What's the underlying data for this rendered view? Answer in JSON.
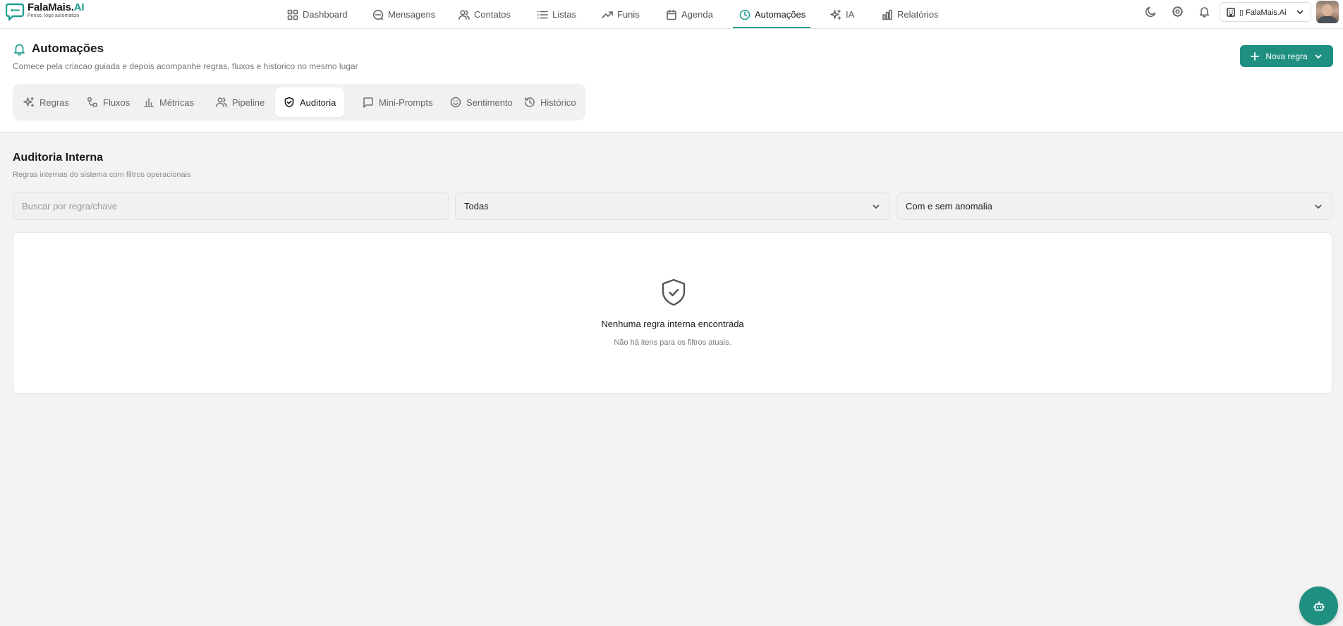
{
  "brand": {
    "name_main": "FalaMais.",
    "name_accent": "AI",
    "tagline": "Penso, logo automatizo"
  },
  "nav": [
    {
      "label": "Dashboard",
      "icon": "grid-icon"
    },
    {
      "label": "Mensagens",
      "icon": "chat-icon"
    },
    {
      "label": "Contatos",
      "icon": "users-icon"
    },
    {
      "label": "Listas",
      "icon": "list-icon"
    },
    {
      "label": "Funis",
      "icon": "trending-icon"
    },
    {
      "label": "Agenda",
      "icon": "calendar-icon"
    },
    {
      "label": "Automações",
      "icon": "clock-icon",
      "active": true
    },
    {
      "label": "IA",
      "icon": "sparkles-icon"
    },
    {
      "label": "Relatórios",
      "icon": "bar-chart-icon"
    }
  ],
  "topbar": {
    "org_label": "▯ FalaMais.Ai"
  },
  "header": {
    "title": "Automações",
    "subtitle": "Comece pela criacao guiada e depois acompanhe regras, fluxos e historico no mesmo lugar",
    "new_rule_label": "Nova regra"
  },
  "tabs": [
    {
      "label": "Regras",
      "icon": "sparkles-icon"
    },
    {
      "label": "Fluxos",
      "icon": "flow-icon"
    },
    {
      "label": "Métricas",
      "icon": "bar-chart-icon"
    },
    {
      "label": "Pipeline",
      "icon": "users-icon"
    },
    {
      "label": "Auditoria",
      "icon": "shield-check-icon",
      "active": true
    },
    {
      "label": "Mini-Prompts",
      "icon": "message-square-icon"
    },
    {
      "label": "Sentimento",
      "icon": "smile-icon"
    },
    {
      "label": "Histórico",
      "icon": "history-icon"
    }
  ],
  "section": {
    "title": "Auditoria Interna",
    "subtitle": "Regras internas do sistema com filtros operacionais"
  },
  "filters": {
    "search_placeholder": "Buscar por regra/chave",
    "scope_value": "Todas",
    "anomaly_value": "Com e sem anomalia"
  },
  "empty_state": {
    "title": "Nenhuma regra interna encontrada",
    "subtitle": "Não há itens para os filtros atuais."
  },
  "colors": {
    "accent": "#1e9f8f",
    "primary_button": "#1f8f80",
    "background": "#f3f3f3"
  }
}
